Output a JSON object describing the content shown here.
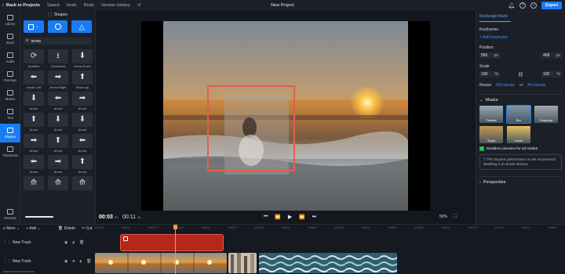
{
  "topbar": {
    "back_label": "Back to Projects",
    "saved_label": "Saved",
    "undo_label": "Undo",
    "redo_label": "Redo",
    "version_history_label": "Version History",
    "project_title": "New Project",
    "export_label": "Export"
  },
  "rail": {
    "items": [
      {
        "label": "Library",
        "icon": "library-icon"
      },
      {
        "label": "Stock",
        "icon": "stock-icon"
      },
      {
        "label": "Audio",
        "icon": "audio-icon"
      },
      {
        "label": "Overlays",
        "icon": "overlays-icon"
      },
      {
        "label": "Motion",
        "icon": "motion-icon"
      },
      {
        "label": "Text",
        "icon": "text-icon"
      },
      {
        "label": "Shapes",
        "icon": "shapes-icon"
      },
      {
        "label": "Transitions",
        "icon": "transitions-icon"
      }
    ],
    "reviews_label": "Reviews"
  },
  "shapes_panel": {
    "title": "Shapes",
    "search_value": "arrow",
    "shapes": [
      {
        "label": "Updates",
        "glyph": "⟳"
      },
      {
        "label": "Download",
        "glyph": "⭳"
      },
      {
        "label": "Arrow Down",
        "glyph": "⬇"
      },
      {
        "label": "Arrow Left",
        "glyph": "⬅"
      },
      {
        "label": "Arrow Right",
        "glyph": "➡"
      },
      {
        "label": "Arrow Up",
        "glyph": "⬆"
      },
      {
        "label": "Arrow",
        "glyph": "⬇"
      },
      {
        "label": "Arrow",
        "glyph": "⬅"
      },
      {
        "label": "Arrow",
        "glyph": "➡"
      },
      {
        "label": "Arrow",
        "glyph": "⬆"
      },
      {
        "label": "Arrow",
        "glyph": "⬇"
      },
      {
        "label": "Arrow",
        "glyph": "⬇"
      },
      {
        "label": "Arrow",
        "glyph": "➡"
      },
      {
        "label": "Arrow",
        "glyph": "⬆"
      },
      {
        "label": "Arrow",
        "glyph": "⬅"
      },
      {
        "label": "Arrow",
        "glyph": "⬅"
      },
      {
        "label": "Arrow",
        "glyph": "➡"
      },
      {
        "label": "Arrow",
        "glyph": "⬆"
      },
      {
        "label": "",
        "glyph": "⟰"
      },
      {
        "label": "",
        "glyph": "⟰"
      },
      {
        "label": "",
        "glyph": "⟰"
      }
    ]
  },
  "player": {
    "current_time": "00:03",
    "current_frames": "01",
    "total_time": "00:11",
    "total_frames": "11",
    "zoom": "50%"
  },
  "inspector": {
    "tab": "Rectangle Mask",
    "keyframes_label": "Keyframes",
    "add_keyframe_label": "+ Add Keyframe",
    "position_label": "Position",
    "pos_x": "560",
    "pos_y": "468",
    "px_unit": "px",
    "scale_label": "Scale",
    "scale_w": "100",
    "scale_h": "100",
    "pct_unit": "%",
    "resize_label": "Resize",
    "fill_canvas_1": "Fill canvas",
    "or_label": "or",
    "fit_canvas": "Fit canvas",
    "masks_label": "Masks",
    "masks": [
      {
        "label": "Pixelate",
        "color": "#9aa8b5"
      },
      {
        "label": "Blur",
        "color": "#7f95aa"
      },
      {
        "label": "Grayscale",
        "color": "#a4a8ad"
      },
      {
        "label": "Sepia",
        "color": "#c79a50"
      },
      {
        "label": "Invert",
        "color": "#e6c160"
      }
    ],
    "realtime_label": "Realtime preview for all masks",
    "info_text": "This impacts performance so we recommend disabling it on slower devices",
    "perspective_label": "Perspective"
  },
  "timeline": {
    "more_label": "More",
    "add_label": "Add",
    "delete_label": "Delete",
    "cut_label": "Cut",
    "ruler_ticks": [
      "0:00.0",
      "0:00.5",
      "0:01.0",
      "0:01.5",
      "0:02.0",
      "0:02.5",
      "0:03.0",
      "0:03.5",
      "0:04.0",
      "0:04.5",
      "0:05.0",
      "0:05.5",
      "0:06.0",
      "0:06.5",
      "0:07.0",
      "0:07.5",
      "0:08.0",
      "0:08.5"
    ],
    "tracks": [
      {
        "label": "New Track"
      },
      {
        "label": "New Track"
      }
    ]
  }
}
